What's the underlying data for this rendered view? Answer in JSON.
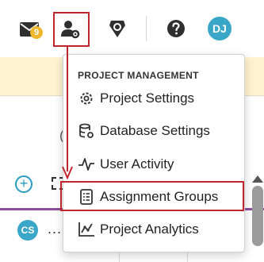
{
  "header": {
    "mail_badge": "9",
    "user_initials": "DJ"
  },
  "menu": {
    "heading": "PROJECT MANAGEMENT",
    "items": [
      {
        "label": "Project Settings",
        "icon": "gear-icon"
      },
      {
        "label": "Database Settings",
        "icon": "database-gear-icon"
      },
      {
        "label": "User Activity",
        "icon": "activity-pulse-icon"
      },
      {
        "label": "Assignment Groups",
        "icon": "assignment-list-icon"
      },
      {
        "label": "Project Analytics",
        "icon": "analytics-chart-icon"
      }
    ]
  },
  "background": {
    "ghost_letter_left": "(",
    "ghost_letter_right": ")",
    "row_avatar": "CS",
    "more_label": "..."
  },
  "colors": {
    "accent": "#2a9dc4",
    "highlight": "#c0252e",
    "badge": "#f0b62e",
    "banner": "#fff3d1",
    "purple": "#8e4f9e"
  }
}
